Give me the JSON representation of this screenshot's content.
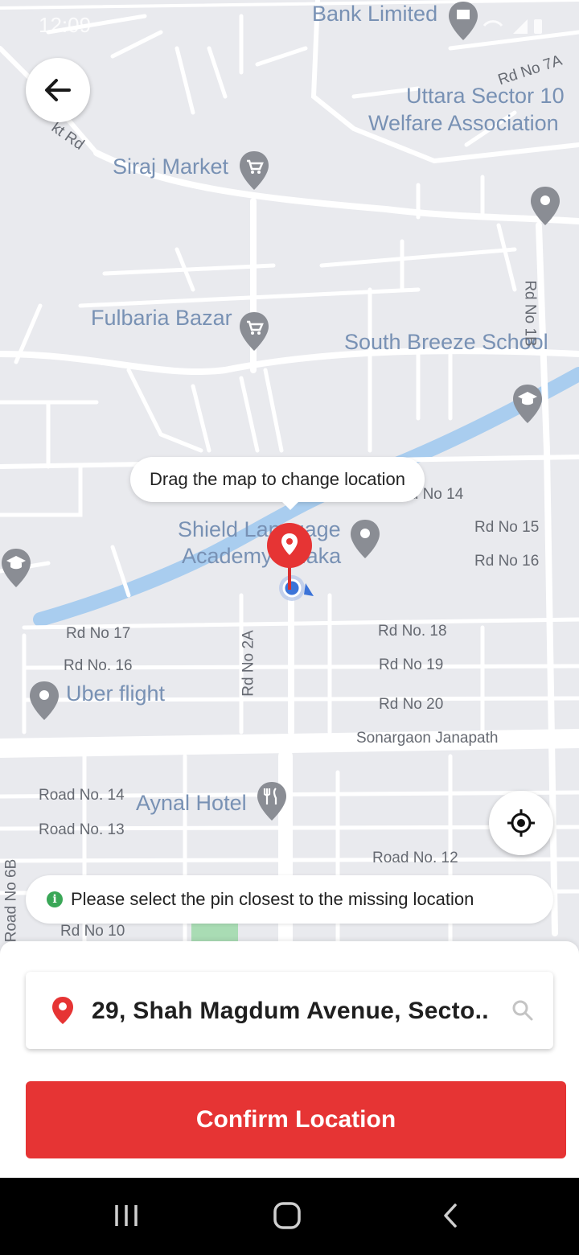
{
  "status_bar": {
    "time": "12:09"
  },
  "map": {
    "places": [
      {
        "name": "Bank Limited"
      },
      {
        "name": "Uttara Sector 10"
      },
      {
        "name": "Welfare Association"
      },
      {
        "name": "Siraj Market"
      },
      {
        "name": "Fulbaria Bazar"
      },
      {
        "name": "South Breeze School"
      },
      {
        "name": "Shield Language"
      },
      {
        "name": "Academy Dhaka"
      },
      {
        "name": "Uber flight"
      },
      {
        "name": "Aynal Hotel"
      }
    ],
    "roads": [
      "Rd No 7A",
      "Rd No 1B",
      "Rd No 14",
      "Rd No 15",
      "Rd No 16",
      "Rd No 17",
      "Rd No. 16",
      "Rd No 2A",
      "Rd No. 18",
      "Rd No 19",
      "Rd No 20",
      "Sonargaon Janapath",
      "Road No. 14",
      "Road No. 13",
      "Road No. 12",
      "Road No 6B",
      "Rd No 10",
      "kt Rd"
    ]
  },
  "tooltip": {
    "text": "Drag the map to change location"
  },
  "hint": {
    "text": "Please select the pin closest to the missing location"
  },
  "address": {
    "text": "29, Shah Magdum Avenue, Secto.."
  },
  "confirm_button": {
    "label": "Confirm Location"
  },
  "colors": {
    "accent": "#e63434",
    "water": "#a9cdef",
    "info": "#3aa757"
  },
  "icons": [
    "back-arrow-icon",
    "location-pin-icon",
    "search-icon",
    "my-location-icon",
    "info-icon"
  ]
}
